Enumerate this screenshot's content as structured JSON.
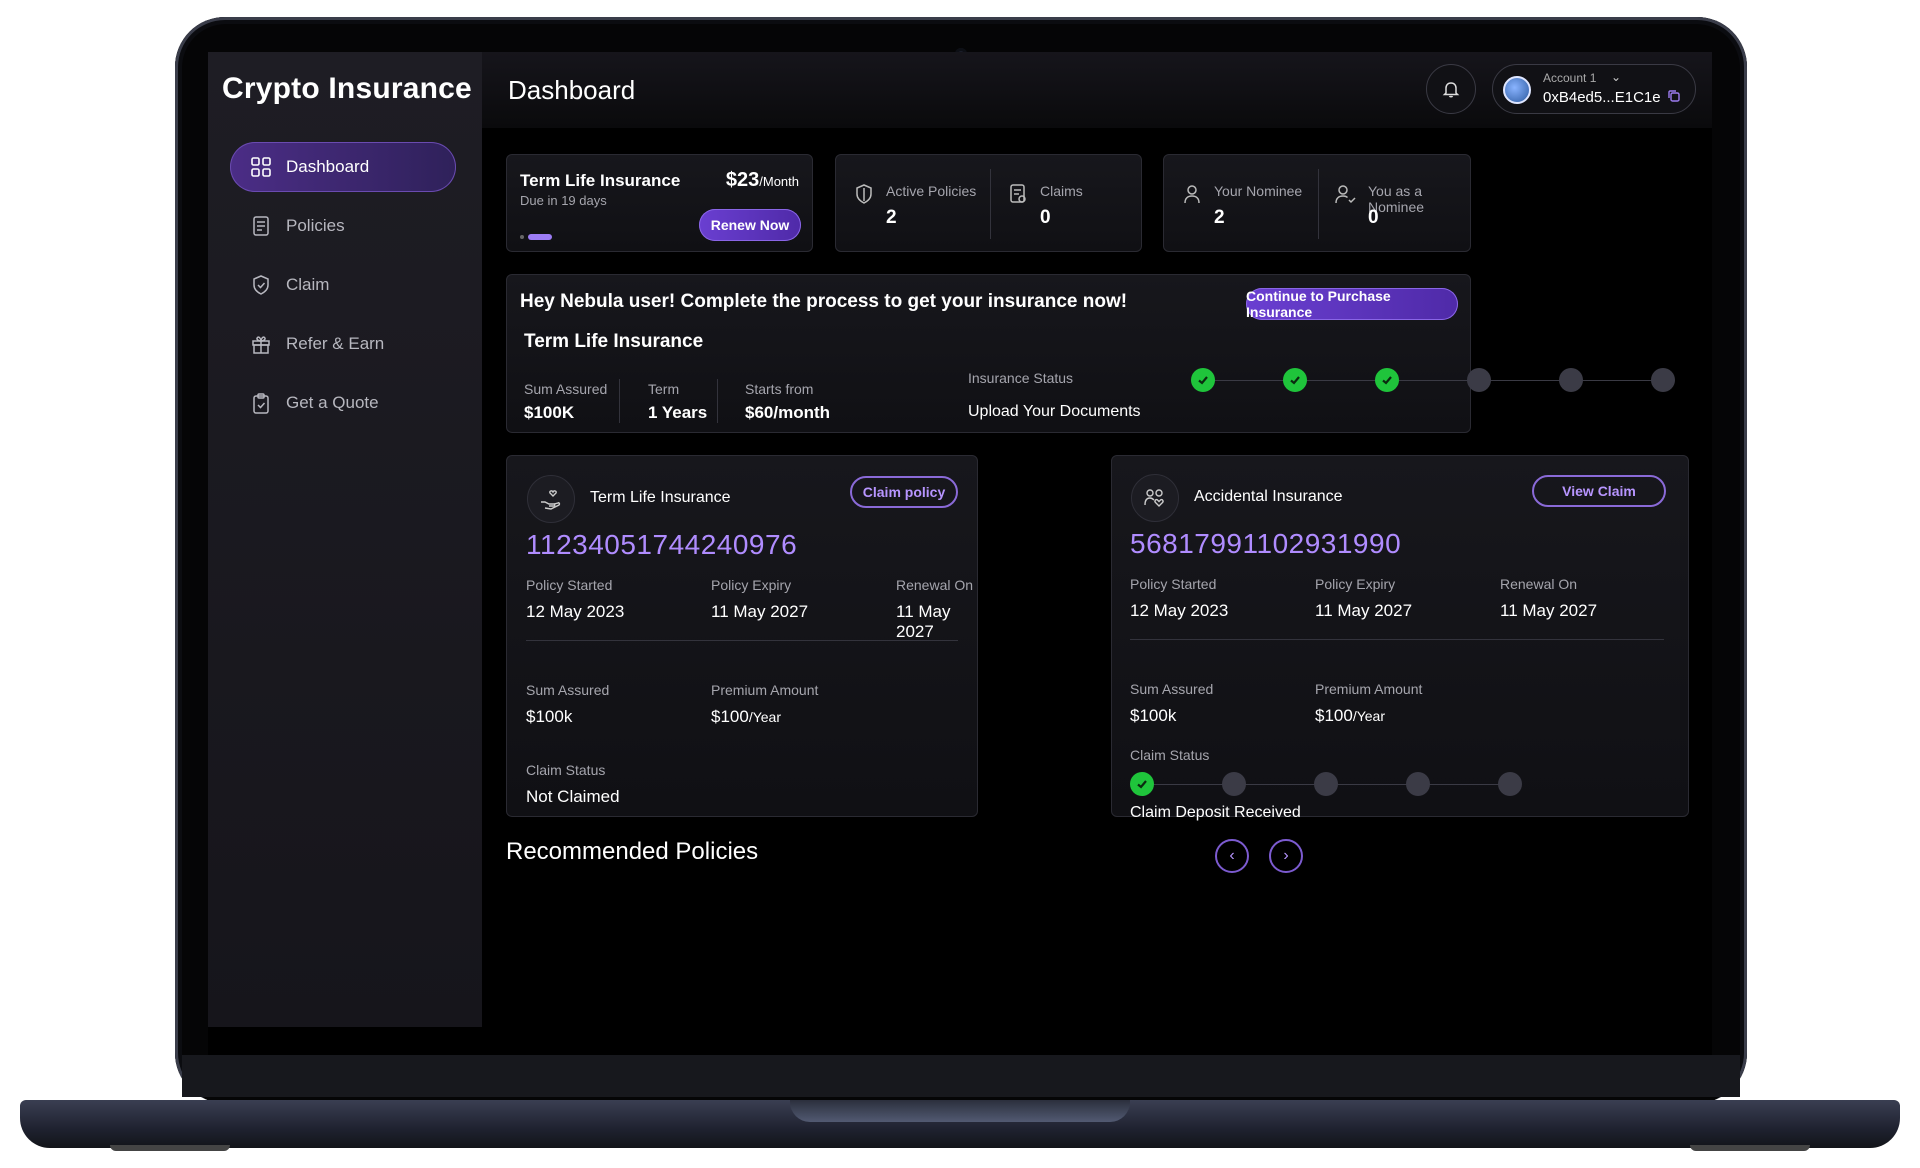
{
  "app": {
    "brand": "Crypto Insurance",
    "page_title": "Dashboard"
  },
  "sidebar": {
    "items": [
      {
        "label": "Dashboard",
        "icon": "grid-icon",
        "active": true
      },
      {
        "label": "Policies",
        "icon": "document-icon"
      },
      {
        "label": "Claim",
        "icon": "shield-check-icon"
      },
      {
        "label": "Refer & Earn",
        "icon": "gift-icon"
      },
      {
        "label": "Get a Quote",
        "icon": "clipboard-check-icon"
      }
    ]
  },
  "header": {
    "account_label": "Account 1",
    "account_address": "0xB4ed5...E1C1e"
  },
  "due_card": {
    "title": "Term Life Insurance",
    "price": "$23",
    "price_unit": "/Month",
    "due": "Due in 19 days",
    "renew_label": "Renew Now"
  },
  "stats": {
    "active_policies_label": "Active Policies",
    "active_policies_value": "2",
    "claims_label": "Claims",
    "claims_value": "0",
    "nominee_label": "Your Nominee",
    "nominee_value": "2",
    "as_nominee_label": "You as a Nominee",
    "as_nominee_value": "0"
  },
  "process": {
    "headline": "Hey Nebula user! Complete the process to get your insurance now!",
    "cta": "Continue to Purchase Insurance",
    "product": "Term Life Insurance",
    "sum_assured_label": "Sum Assured",
    "sum_assured_value": "$100K",
    "term_label": "Term",
    "term_value": "1 Years",
    "starts_label": "Starts from",
    "starts_value": "$60/month",
    "status_label": "Insurance Status",
    "status_text": "Upload Your Documents",
    "steps_total": 6,
    "steps_done": 3
  },
  "policies": [
    {
      "name": "Term Life Insurance",
      "icon": "hand-heart-icon",
      "action": "Claim policy",
      "number": "11234051744240976",
      "started_label": "Policy Started",
      "started": "12 May 2023",
      "expiry_label": "Policy Expiry",
      "expiry": "11 May 2027",
      "renewal_label": "Renewal On",
      "renewal": "11 May 2027",
      "sum_label": "Sum Assured",
      "sum": "$100k",
      "premium_label": "Premium Amount",
      "premium": "$100",
      "premium_unit": "/Year",
      "claim_status_label": "Claim Status",
      "claim_status": "Not Claimed"
    },
    {
      "name": "Accidental Insurance",
      "icon": "people-heart-icon",
      "action": "View Claim",
      "number": "56817991102931990",
      "started_label": "Policy Started",
      "started": "12 May 2023",
      "expiry_label": "Policy Expiry",
      "expiry": "11 May 2027",
      "renewal_label": "Renewal On",
      "renewal": "11 May 2027",
      "sum_label": "Sum Assured",
      "sum": "$100k",
      "premium_label": "Premium Amount",
      "premium": "$100",
      "premium_unit": "/Year",
      "claim_status_label": "Claim Status",
      "claim_status": "Claim Deposit Received",
      "claim_steps_total": 5,
      "claim_steps_done": 1
    }
  ],
  "recommended": {
    "title": "Recommended Policies"
  },
  "colors": {
    "accent": "#6a3fd1",
    "accent_text": "#b08cff",
    "success": "#1fc43b"
  }
}
